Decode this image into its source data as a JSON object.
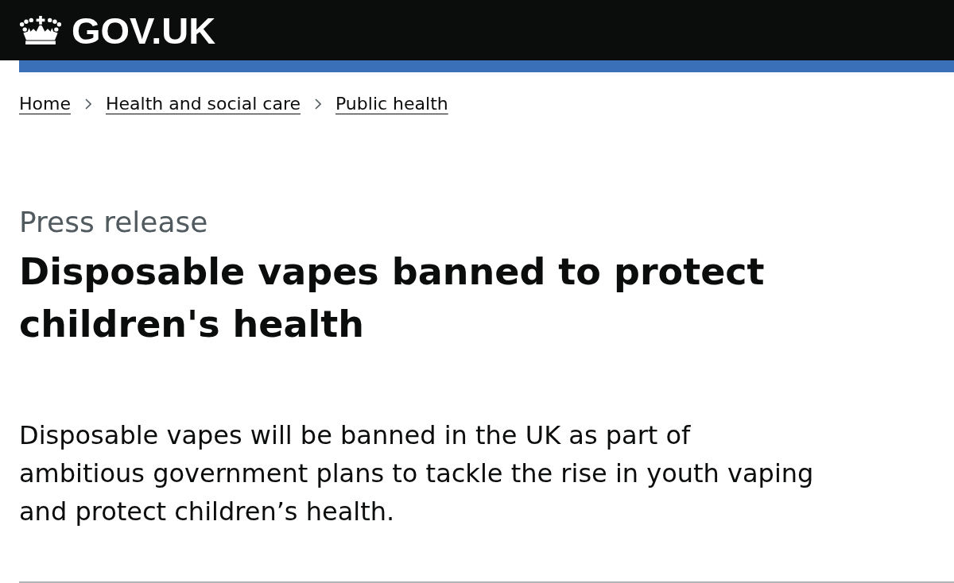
{
  "header": {
    "logo_text": "GOV.UK"
  },
  "breadcrumbs": [
    {
      "label": "Home"
    },
    {
      "label": "Health and social care"
    },
    {
      "label": "Public health"
    }
  ],
  "document_type": "Press release",
  "title": "Disposable vapes banned to protect children's health",
  "lead": "Disposable vapes will be banned in the UK as part of ambitious government plans to tackle the rise in youth vaping and protect children’s health."
}
